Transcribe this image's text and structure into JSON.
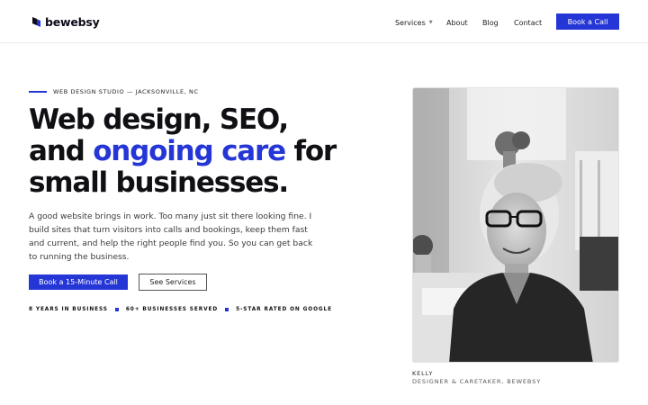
{
  "brand": {
    "name": "bewebsy",
    "logo_icon": "bewebsy-logo-mark",
    "accent_color": "#2536d6"
  },
  "nav": {
    "items": [
      {
        "label": "Services",
        "has_dropdown": true
      },
      {
        "label": "About"
      },
      {
        "label": "Blog"
      },
      {
        "label": "Contact"
      }
    ],
    "cta_label": "Book a Call"
  },
  "hero": {
    "eyebrow": "WEB DESIGN STUDIO — JACKSONVILLE, NC",
    "headline": {
      "line1": "Web design, SEO,",
      "line2_prefix": "and",
      "line2_accent": "ongoing care",
      "line2_suffix": "for",
      "line3": "small businesses."
    },
    "lead": "A good website brings in work. Too many just sit there looking fine. I build sites that turn visitors into calls and bookings, keep them fast and current, and help the right people find you. So you can get back to running the business.",
    "primary_button": "Book a 15-Minute Call",
    "secondary_button": "See Services",
    "stats": [
      "8 YEARS IN BUSINESS",
      "60+ BUSINESSES SERVED",
      "5-STAR RATED ON GOOGLE"
    ]
  },
  "portrait": {
    "name": "KELLY",
    "role": "DESIGNER & CARETAKER, BEWEBSY"
  }
}
